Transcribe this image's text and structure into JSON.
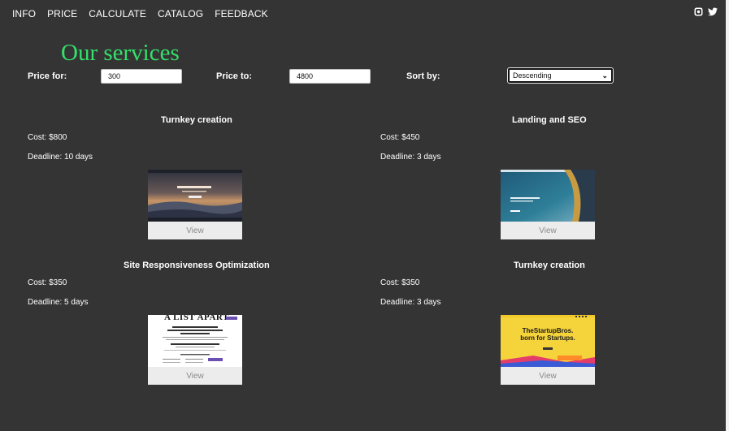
{
  "nav": {
    "items": [
      {
        "label": "INFO"
      },
      {
        "label": "PRICE"
      },
      {
        "label": "CALCULATE"
      },
      {
        "label": "CATALOG"
      },
      {
        "label": "FEEDBACK"
      }
    ],
    "social_icons": [
      "instagram-icon",
      "twitter-icon"
    ]
  },
  "page_title": "Our services",
  "filters": {
    "price_for_label": "Price for:",
    "price_for_value": "300",
    "price_to_label": "Price to:",
    "price_to_value": "4800",
    "sort_label": "Sort by:",
    "sort_value": "Descending"
  },
  "services": [
    {
      "name": "Turnkey creation",
      "cost": "Cost: $800",
      "deadline": "Deadline: 10 days",
      "view_label": "View"
    },
    {
      "name": "Landing and SEO",
      "cost": "Cost: $450",
      "deadline": "Deadline: 3 days",
      "view_label": "View"
    },
    {
      "name": "Site Responsiveness Optimization",
      "cost": "Cost: $350",
      "deadline": "Deadline: 5 days",
      "view_label": "View",
      "thumb_text": {
        "headline": "A LIST APART"
      }
    },
    {
      "name": "Turnkey creation",
      "cost": "Cost: $350",
      "deadline": "Deadline: 3 days",
      "view_label": "View",
      "thumb_text": {
        "line1": "TheStartupBros.",
        "line2": "born for Startups."
      }
    }
  ],
  "colors": {
    "background": "#343434",
    "title": "#34e06a",
    "button": "#ececec"
  }
}
